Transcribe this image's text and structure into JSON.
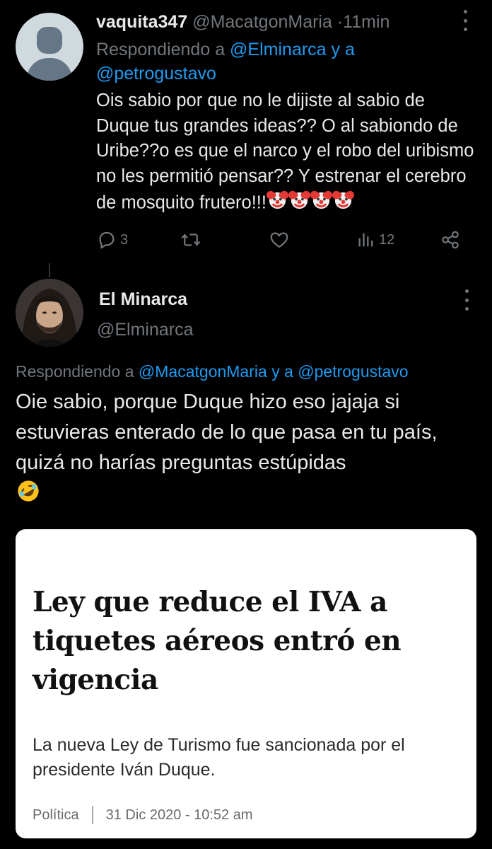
{
  "tweet1": {
    "display_name": "vaquita347",
    "handle": "@MacatgonMaria",
    "dot": "·",
    "time": "11min",
    "reply_prefix": "Respondiendo a",
    "reply_user1": "@Elminarca",
    "reply_join": "y a",
    "reply_user2": "@petrogustavo",
    "text": "Ois sabio por que no le dijiste al sabio de Duque tus grandes ideas?? O al sabiondo de Uribe??o es que el narco y el robo del uribismo no les permitió pensar?? Y estrenar el cerebro de mosquito frutero!!!",
    "emojis": [
      "clown-face",
      "clown-face",
      "clown-face",
      "clown-face"
    ],
    "actions": {
      "reply_count": "3",
      "retweet_count": "",
      "like_count": "",
      "views_count": "12"
    }
  },
  "tweet2": {
    "display_name": "El Minarca",
    "handle": "@Elminarca",
    "reply_prefix": "Respondiendo a",
    "reply_user1": "@MacatgonMaria",
    "reply_join": "y a",
    "reply_user2": "@petrogustavo",
    "text": "Oie sabio, porque Duque hizo eso jajaja si estuvieras enterado de lo que pasa en tu país, quizá no harías preguntas estúpidas",
    "emoji": "rolling-on-floor-laughing"
  },
  "card": {
    "title": "Ley que reduce el IVA a tiquetes aéreos entró en vigencia",
    "subtitle": "La nueva Ley de Turismo fue sancionada por el presidente Iván Duque.",
    "category": "Política",
    "date": "31 Dic 2020 - 10:52 am"
  },
  "colors": {
    "background": "#000000",
    "text": "#e7e9ea",
    "muted": "#71767b",
    "link": "#1d9bf0",
    "card_bg": "#ffffff"
  }
}
